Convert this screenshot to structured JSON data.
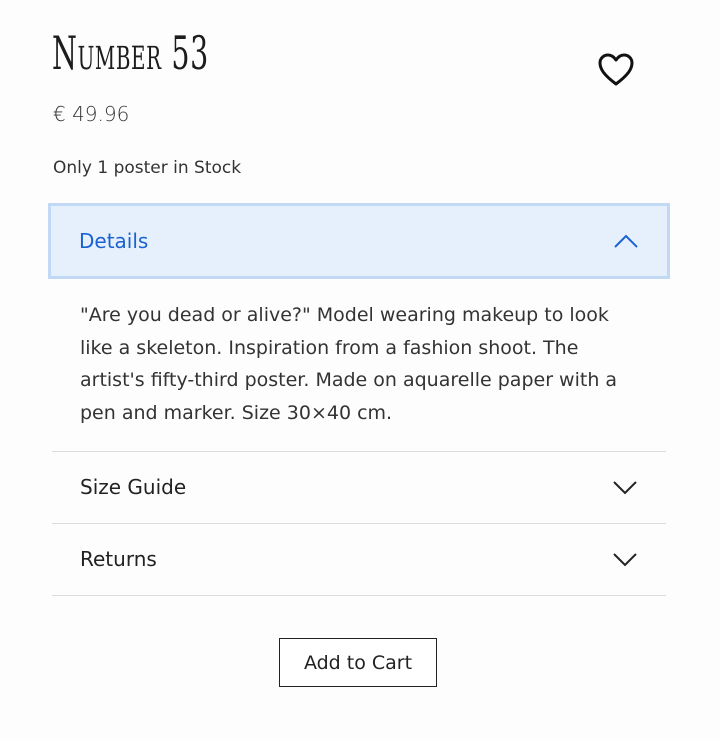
{
  "product": {
    "title": "Number 53",
    "price": "€ 49.96",
    "stock": "Only 1 poster in Stock"
  },
  "icons": {
    "favorite": "heart-icon",
    "expanded": "chevron-up-icon",
    "collapsed": "chevron-down-icon"
  },
  "accordion": {
    "details": {
      "label": "Details",
      "body": "\"Are you dead or alive?\" Model wearing makeup to look like a skeleton. Inspiration from a fashion shoot. The artist's fifty-third poster. Made on aquarelle paper with a pen and marker. Size 30×40 cm."
    },
    "size_guide": {
      "label": "Size Guide"
    },
    "returns": {
      "label": "Returns"
    }
  },
  "actions": {
    "add_to_cart": "Add to Cart"
  },
  "colors": {
    "accent": "#1a62d2",
    "open_bg": "#e6f0fc",
    "open_border": "#c2d9f6",
    "divider": "#dcdcdc"
  }
}
